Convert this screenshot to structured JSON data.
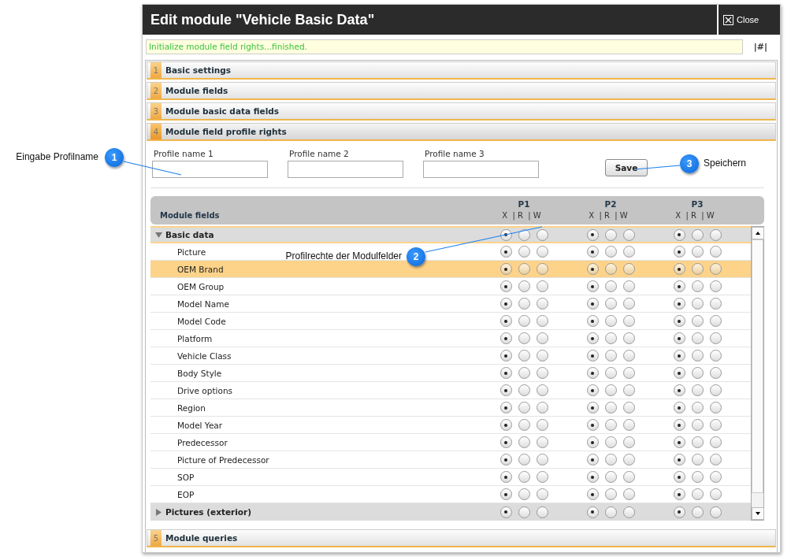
{
  "window": {
    "title": "Edit module \"Vehicle Basic Data\"",
    "close_label": "Close"
  },
  "status": {
    "message": "Initialize module field rights...finished.",
    "anchor": "|#|"
  },
  "sections": [
    {
      "number": "1",
      "label": "Basic settings",
      "expanded": false
    },
    {
      "number": "2",
      "label": "Module fields",
      "expanded": false
    },
    {
      "number": "3",
      "label": "Module basic data fields",
      "expanded": false
    },
    {
      "number": "4",
      "label": "Module field profile rights",
      "expanded": true
    },
    {
      "number": "5",
      "label": "Module queries",
      "expanded": false
    }
  ],
  "profile_fields": [
    {
      "label": "Profile name 1"
    },
    {
      "label": "Profile name 2"
    },
    {
      "label": "Profile name 3"
    }
  ],
  "save_button": "Save",
  "table": {
    "name_column": "Module fields",
    "profiles": [
      {
        "name": "P1",
        "rights_label": "X  | R  | W"
      },
      {
        "name": "P2",
        "rights_label": "X  | R  | W"
      },
      {
        "name": "P3",
        "rights_label": "X  | R  | W"
      }
    ],
    "rows": [
      {
        "kind": "group",
        "label": "Basic data",
        "expanded": true,
        "selected": false,
        "rights": [
          [
            {
              "selected": true
            },
            {
              "selected": false
            },
            {
              "selected": false
            }
          ],
          [
            {
              "selected": true
            },
            {
              "selected": false
            },
            {
              "selected": false
            }
          ],
          [
            {
              "selected": true
            },
            {
              "selected": false
            },
            {
              "selected": false
            }
          ]
        ],
        "children": [
          {
            "kind": "field",
            "label": "Picture",
            "selected": false,
            "rights": [
              [
                {
                  "selected": true
                },
                {
                  "selected": false
                },
                {
                  "selected": false
                }
              ],
              [
                {
                  "selected": true
                },
                {
                  "selected": false
                },
                {
                  "selected": false
                }
              ],
              [
                {
                  "selected": true
                },
                {
                  "selected": false
                },
                {
                  "selected": false
                }
              ]
            ]
          },
          {
            "kind": "field",
            "label": "OEM Brand",
            "selected": true,
            "rights": [
              [
                {
                  "selected": true
                },
                {
                  "selected": false
                },
                {
                  "selected": false
                }
              ],
              [
                {
                  "selected": true
                },
                {
                  "selected": false
                },
                {
                  "selected": false
                }
              ],
              [
                {
                  "selected": true
                },
                {
                  "selected": false
                },
                {
                  "selected": false
                }
              ]
            ]
          },
          {
            "kind": "field",
            "label": "OEM Group",
            "selected": false,
            "rights": [
              [
                {
                  "selected": true
                },
                {
                  "selected": false
                },
                {
                  "selected": false
                }
              ],
              [
                {
                  "selected": true
                },
                {
                  "selected": false
                },
                {
                  "selected": false
                }
              ],
              [
                {
                  "selected": true
                },
                {
                  "selected": false
                },
                {
                  "selected": false
                }
              ]
            ]
          },
          {
            "kind": "field",
            "label": "Model Name",
            "selected": false,
            "rights": [
              [
                {
                  "selected": true
                },
                {
                  "selected": false
                },
                {
                  "selected": false
                }
              ],
              [
                {
                  "selected": true
                },
                {
                  "selected": false
                },
                {
                  "selected": false
                }
              ],
              [
                {
                  "selected": true
                },
                {
                  "selected": false
                },
                {
                  "selected": false
                }
              ]
            ]
          },
          {
            "kind": "field",
            "label": "Model Code",
            "selected": false,
            "rights": [
              [
                {
                  "selected": true
                },
                {
                  "selected": false
                },
                {
                  "selected": false
                }
              ],
              [
                {
                  "selected": true
                },
                {
                  "selected": false
                },
                {
                  "selected": false
                }
              ],
              [
                {
                  "selected": true
                },
                {
                  "selected": false
                },
                {
                  "selected": false
                }
              ]
            ]
          },
          {
            "kind": "field",
            "label": "Platform",
            "selected": false,
            "rights": [
              [
                {
                  "selected": true
                },
                {
                  "selected": false
                },
                {
                  "selected": false
                }
              ],
              [
                {
                  "selected": true
                },
                {
                  "selected": false
                },
                {
                  "selected": false
                }
              ],
              [
                {
                  "selected": true
                },
                {
                  "selected": false
                },
                {
                  "selected": false
                }
              ]
            ]
          },
          {
            "kind": "field",
            "label": "Vehicle Class",
            "selected": false,
            "rights": [
              [
                {
                  "selected": true
                },
                {
                  "selected": false
                },
                {
                  "selected": false
                }
              ],
              [
                {
                  "selected": true
                },
                {
                  "selected": false
                },
                {
                  "selected": false
                }
              ],
              [
                {
                  "selected": true
                },
                {
                  "selected": false
                },
                {
                  "selected": false
                }
              ]
            ]
          },
          {
            "kind": "field",
            "label": "Body Style",
            "selected": false,
            "rights": [
              [
                {
                  "selected": true
                },
                {
                  "selected": false
                },
                {
                  "selected": false
                }
              ],
              [
                {
                  "selected": true
                },
                {
                  "selected": false
                },
                {
                  "selected": false
                }
              ],
              [
                {
                  "selected": true
                },
                {
                  "selected": false
                },
                {
                  "selected": false
                }
              ]
            ]
          },
          {
            "kind": "field",
            "label": "Drive options",
            "selected": false,
            "rights": [
              [
                {
                  "selected": true
                },
                {
                  "selected": false
                },
                {
                  "selected": false
                }
              ],
              [
                {
                  "selected": true
                },
                {
                  "selected": false
                },
                {
                  "selected": false
                }
              ],
              [
                {
                  "selected": true
                },
                {
                  "selected": false
                },
                {
                  "selected": false
                }
              ]
            ]
          },
          {
            "kind": "field",
            "label": "Region",
            "selected": false,
            "rights": [
              [
                {
                  "selected": true
                },
                {
                  "selected": false
                },
                {
                  "selected": false
                }
              ],
              [
                {
                  "selected": true
                },
                {
                  "selected": false
                },
                {
                  "selected": false
                }
              ],
              [
                {
                  "selected": true
                },
                {
                  "selected": false
                },
                {
                  "selected": false
                }
              ]
            ]
          },
          {
            "kind": "field",
            "label": "Model Year",
            "selected": false,
            "rights": [
              [
                {
                  "selected": true
                },
                {
                  "selected": false
                },
                {
                  "selected": false
                }
              ],
              [
                {
                  "selected": true
                },
                {
                  "selected": false
                },
                {
                  "selected": false
                }
              ],
              [
                {
                  "selected": true
                },
                {
                  "selected": false
                },
                {
                  "selected": false
                }
              ]
            ]
          },
          {
            "kind": "field",
            "label": "Predecessor",
            "selected": false,
            "rights": [
              [
                {
                  "selected": true
                },
                {
                  "selected": false
                },
                {
                  "selected": false
                }
              ],
              [
                {
                  "selected": true
                },
                {
                  "selected": false
                },
                {
                  "selected": false
                }
              ],
              [
                {
                  "selected": true
                },
                {
                  "selected": false
                },
                {
                  "selected": false
                }
              ]
            ]
          },
          {
            "kind": "field",
            "label": "Picture of Predecessor",
            "selected": false,
            "rights": [
              [
                {
                  "selected": true
                },
                {
                  "selected": false
                },
                {
                  "selected": false
                }
              ],
              [
                {
                  "selected": true
                },
                {
                  "selected": false
                },
                {
                  "selected": false
                }
              ],
              [
                {
                  "selected": true
                },
                {
                  "selected": false
                },
                {
                  "selected": false
                }
              ]
            ]
          },
          {
            "kind": "field",
            "label": "SOP",
            "selected": false,
            "rights": [
              [
                {
                  "selected": true
                },
                {
                  "selected": false
                },
                {
                  "selected": false
                }
              ],
              [
                {
                  "selected": true
                },
                {
                  "selected": false
                },
                {
                  "selected": false
                }
              ],
              [
                {
                  "selected": true
                },
                {
                  "selected": false
                },
                {
                  "selected": false
                }
              ]
            ]
          },
          {
            "kind": "field",
            "label": "EOP",
            "selected": false,
            "rights": [
              [
                {
                  "selected": true
                },
                {
                  "selected": false
                },
                {
                  "selected": false
                }
              ],
              [
                {
                  "selected": true
                },
                {
                  "selected": false
                },
                {
                  "selected": false
                }
              ],
              [
                {
                  "selected": true
                },
                {
                  "selected": false
                },
                {
                  "selected": false
                }
              ]
            ]
          }
        ]
      },
      {
        "kind": "group",
        "label": "Pictures (exterior)",
        "expanded": false,
        "selected": false,
        "rights": [
          [
            {
              "selected": true
            },
            {
              "selected": false
            },
            {
              "selected": false
            }
          ],
          [
            {
              "selected": true
            },
            {
              "selected": false
            },
            {
              "selected": false
            }
          ],
          [
            {
              "selected": true
            },
            {
              "selected": false
            },
            {
              "selected": false
            }
          ]
        ]
      }
    ]
  },
  "callouts": [
    {
      "number": "1",
      "label": "Eingabe Profilname"
    },
    {
      "number": "2",
      "label": "Profilrechte der Modulfelder"
    },
    {
      "number": "3",
      "label": "Speichern"
    }
  ]
}
